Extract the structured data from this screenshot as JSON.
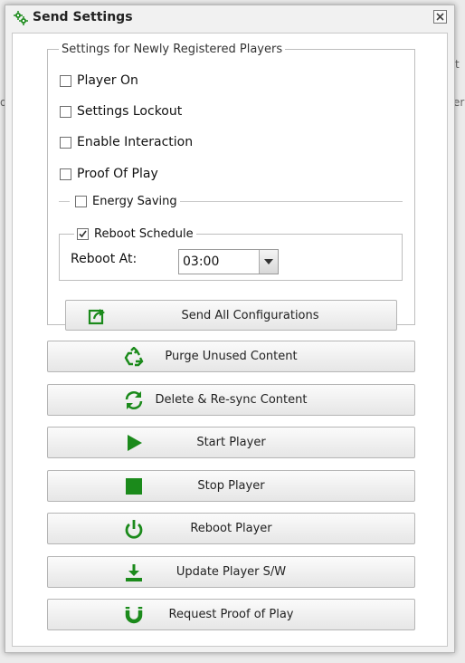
{
  "background": {
    "right_top_text": "t",
    "right_mid_text": "er",
    "left_mid_text": "o"
  },
  "dialog": {
    "title": "Send Settings",
    "close_label": "×"
  },
  "new_players": {
    "legend": "Settings for Newly Registered Players",
    "options": [
      {
        "label": "Player On",
        "checked": false
      },
      {
        "label": "Settings Lockout",
        "checked": false
      },
      {
        "label": "Enable Interaction",
        "checked": false
      },
      {
        "label": "Proof Of Play",
        "checked": false
      }
    ],
    "energy_saving": {
      "label": "Energy Saving",
      "checked": false
    },
    "reboot_schedule": {
      "label": "Reboot Schedule",
      "checked": true,
      "reboot_at_label": "Reboot At:",
      "reboot_at_value": "03:00"
    },
    "send_all_label": "Send All Configurations"
  },
  "actions": [
    {
      "label": "Purge Unused Content",
      "icon": "recycle-icon"
    },
    {
      "label": "Delete & Re-sync Content",
      "icon": "refresh-icon"
    },
    {
      "label": "Start Player",
      "icon": "play-icon"
    },
    {
      "label": "Stop Player",
      "icon": "stop-icon"
    },
    {
      "label": "Reboot Player",
      "icon": "power-icon"
    },
    {
      "label": "Update Player S/W",
      "icon": "download-icon"
    },
    {
      "label": "Request Proof of Play",
      "icon": "magnet-icon"
    }
  ],
  "colors": {
    "icon_green": "#1b8a1b"
  }
}
